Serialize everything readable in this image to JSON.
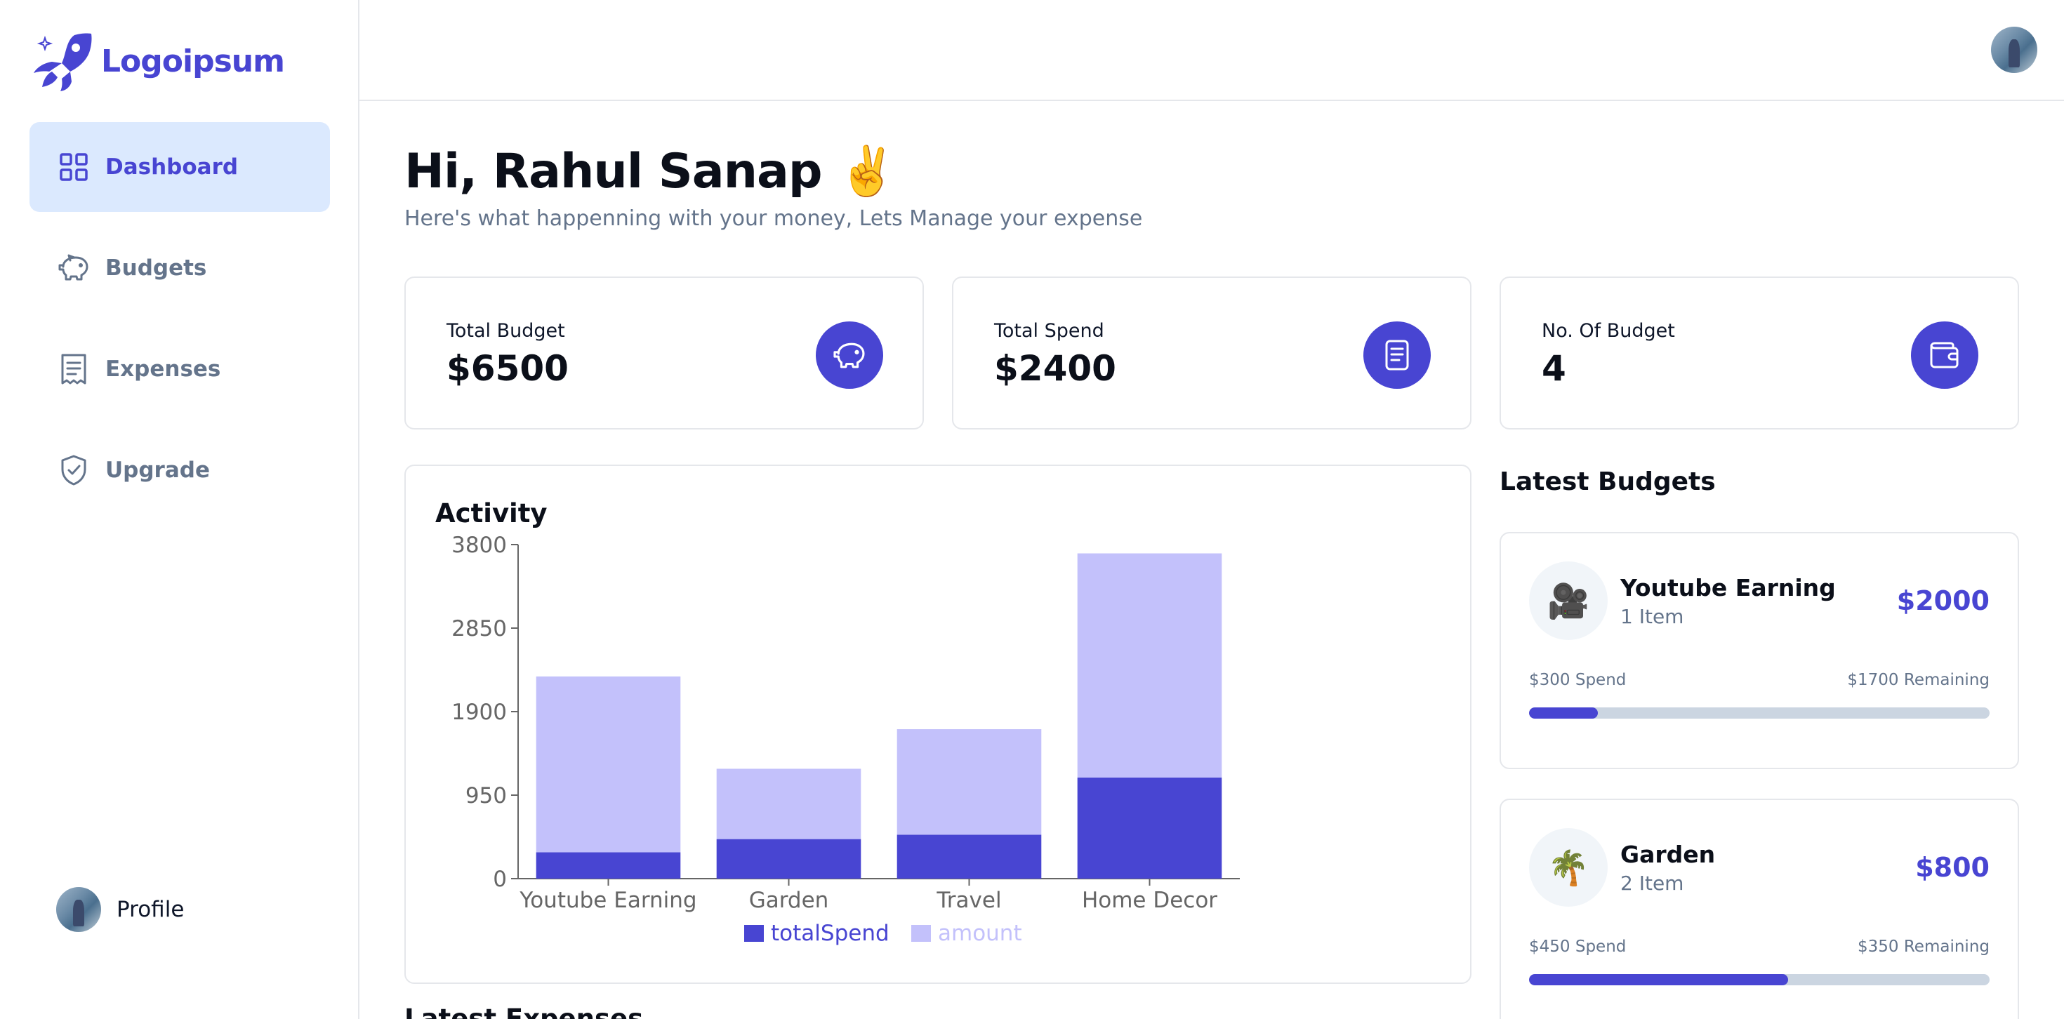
{
  "brand": {
    "name": "Logoipsum",
    "accent": "#4845d2"
  },
  "sidebar": {
    "items": [
      {
        "label": "Dashboard",
        "icon": "dashboard-grid-icon",
        "active": true
      },
      {
        "label": "Budgets",
        "icon": "piggy-bank-icon",
        "active": false
      },
      {
        "label": "Expenses",
        "icon": "receipt-icon",
        "active": false
      },
      {
        "label": "Upgrade",
        "icon": "shield-check-icon",
        "active": false
      }
    ],
    "profile_label": "Profile"
  },
  "main": {
    "greeting": "Hi, Rahul Sanap ✌️",
    "subtitle": "Here's what happenning with your money, Lets Manage your expense",
    "stats": [
      {
        "label": "Total Budget",
        "value": "$6500",
        "icon": "piggy-bank-icon"
      },
      {
        "label": "Total Spend",
        "value": "$2400",
        "icon": "receipt-icon"
      },
      {
        "label": "No. Of Budget",
        "value": "4",
        "icon": "wallet-icon"
      }
    ],
    "activity_title": "Activity",
    "latest_expenses_title": "Latest Expenses"
  },
  "chart_data": {
    "type": "bar",
    "stacked": true,
    "categories": [
      "Youtube Earning",
      "Garden",
      "Travel",
      "Home Decor"
    ],
    "series": [
      {
        "name": "totalSpend",
        "color": "#4845d2",
        "values": [
          300,
          450,
          500,
          1150
        ]
      },
      {
        "name": "amount",
        "color": "#c3c1fb",
        "values": [
          2000,
          800,
          1200,
          2550
        ]
      }
    ],
    "yticks": [
      "0",
      "950",
      "1900",
      "2850",
      "3800"
    ],
    "ylim": [
      0,
      3800
    ],
    "legend": "bottom",
    "grid": false
  },
  "latest_budgets": {
    "title": "Latest Budgets",
    "items": [
      {
        "emoji": "🎥",
        "name": "Youtube Earning",
        "count": "1 Item",
        "amount": "$2000",
        "spend": "$300 Spend",
        "remaining": "$1700 Remaining",
        "progress": 0.15
      },
      {
        "emoji": "🌴",
        "name": "Garden",
        "count": "2 Item",
        "amount": "$800",
        "spend": "$450 Spend",
        "remaining": "$350 Remaining",
        "progress": 0.5625
      }
    ]
  }
}
